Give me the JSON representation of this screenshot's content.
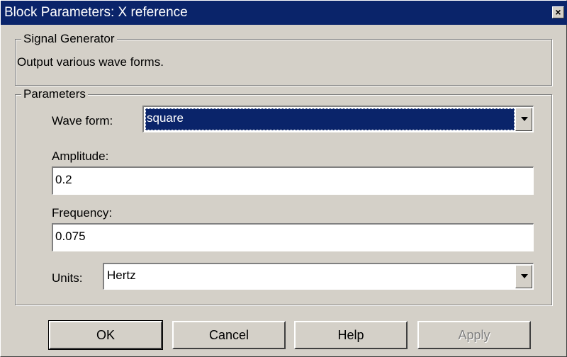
{
  "window": {
    "title": "Block Parameters: X reference",
    "close_glyph": "×"
  },
  "description_group": {
    "legend": "Signal Generator",
    "text": "Output various wave forms."
  },
  "parameters_group": {
    "legend": "Parameters",
    "wave_form": {
      "label": "Wave form:",
      "value": "square"
    },
    "amplitude": {
      "label": "Amplitude:",
      "value": "0.2"
    },
    "frequency": {
      "label": "Frequency:",
      "value": "0.075"
    },
    "units": {
      "label": "Units:",
      "value": "Hertz"
    }
  },
  "buttons": {
    "ok": "OK",
    "cancel": "Cancel",
    "help": "Help",
    "apply": "Apply"
  },
  "colors": {
    "titlebar": "#0a246a",
    "face": "#d4d0c8",
    "selection": "#0a246a"
  }
}
